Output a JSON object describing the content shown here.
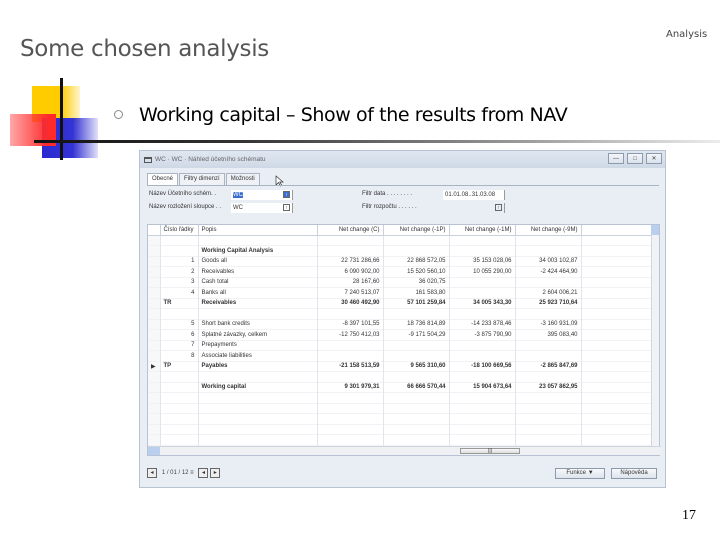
{
  "slide": {
    "title": "Some chosen  analysis",
    "tag": "Analysis",
    "number": "17",
    "bullet": "Working capital – Show of the results from NAV"
  },
  "window": {
    "title": "WC · WC · Náhled účetního schématu",
    "icon": "window-icon",
    "buttons": {
      "minimize": "—",
      "restore": "□",
      "close": "✕"
    },
    "tabs": [
      "Obecné",
      "Filtry dimenzí",
      "Možnosti"
    ],
    "fields": {
      "schema_label": "Název Účetního schém. .",
      "schema_value": "WC",
      "layout_label": "Název rozložení sloupce . .",
      "layout_value": "WC",
      "date_filter_label": "Filtr data . . . . . . . .",
      "date_filter_value": "01.01.08..31.03.08",
      "budget_filter_label": "Filtr rozpočtu . . . . . .",
      "budget_filter_value": ""
    },
    "grid": {
      "headers": [
        "Číslo řádky",
        "Popis",
        "Net change (C)",
        "Net change (-1P)",
        "Net change (-1M)",
        "Net change (-9M)"
      ],
      "rows": [
        {
          "no": "",
          "desc": "",
          "c": "",
          "p1": "",
          "m1": "",
          "m9": "",
          "bold": false,
          "marker": ""
        },
        {
          "no": "",
          "desc": "Working Capital Analysis",
          "c": "",
          "p1": "",
          "m1": "",
          "m9": "",
          "bold": true,
          "marker": ""
        },
        {
          "no": "1",
          "desc": "Goods all",
          "c": "22 731 286,66",
          "p1": "22 868 572,05",
          "m1": "35 153 028,06",
          "m9": "34 003 102,87",
          "bold": false,
          "marker": ""
        },
        {
          "no": "2",
          "desc": "Receivables",
          "c": "6 090 902,00",
          "p1": "15 520 560,10",
          "m1": "10 055 290,00",
          "m9": "-2 424 464,90",
          "bold": false,
          "marker": ""
        },
        {
          "no": "3",
          "desc": "Cash total",
          "c": "28 167,60",
          "p1": "36 020,75",
          "m1": "",
          "m9": "",
          "bold": false,
          "marker": ""
        },
        {
          "no": "4",
          "desc": "Banks all",
          "c": "7 240 513,07",
          "p1": "161 583,80",
          "m1": "",
          "m9": "2 604 006,21",
          "bold": false,
          "marker": ""
        },
        {
          "no": "TR",
          "desc": "Receivables",
          "c": "30 460 492,90",
          "p1": "57 101 259,84",
          "m1": "34 005 343,30",
          "m9": "25 923 710,64",
          "bold": true,
          "marker": ""
        },
        {
          "no": "",
          "desc": "",
          "c": "",
          "p1": "",
          "m1": "",
          "m9": "",
          "bold": false,
          "marker": ""
        },
        {
          "no": "5",
          "desc": "Short bank credits",
          "c": "-8 397 101,55",
          "p1": "18 736 814,89",
          "m1": "-14 233 878,46",
          "m9": "-3 160 931,09",
          "bold": false,
          "marker": ""
        },
        {
          "no": "6",
          "desc": "Splatné závazky, celkem",
          "c": "-12 750 412,03",
          "p1": "-9 171 504,29",
          "m1": "-3 875 790,90",
          "m9": "395 083,40",
          "bold": false,
          "marker": ""
        },
        {
          "no": "7",
          "desc": "Prepayments",
          "c": "",
          "p1": "",
          "m1": "",
          "m9": "",
          "bold": false,
          "marker": ""
        },
        {
          "no": "8",
          "desc": "Associate liabilities",
          "c": "",
          "p1": "",
          "m1": "",
          "m9": "",
          "bold": false,
          "marker": ""
        },
        {
          "no": "TP",
          "desc": "Payables",
          "c": "-21 158 513,59",
          "p1": "9 565 310,60",
          "m1": "-18 100 669,56",
          "m9": "-2 865 847,69",
          "bold": true,
          "marker": "▶"
        },
        {
          "no": "",
          "desc": "",
          "c": "",
          "p1": "",
          "m1": "",
          "m9": "",
          "bold": false,
          "marker": ""
        },
        {
          "no": "",
          "desc": "Working capital",
          "c": "9 301 979,31",
          "p1": "66 666 570,44",
          "m1": "15 904 673,64",
          "m9": "23 057 862,95",
          "bold": true,
          "marker": ""
        },
        {
          "no": "",
          "desc": "",
          "c": "",
          "p1": "",
          "m1": "",
          "m9": "",
          "bold": false,
          "marker": ""
        },
        {
          "no": "",
          "desc": "",
          "c": "",
          "p1": "",
          "m1": "",
          "m9": "",
          "bold": false,
          "marker": ""
        },
        {
          "no": "",
          "desc": "",
          "c": "",
          "p1": "",
          "m1": "",
          "m9": "",
          "bold": false,
          "marker": ""
        },
        {
          "no": "",
          "desc": "",
          "c": "",
          "p1": "",
          "m1": "",
          "m9": "",
          "bold": false,
          "marker": ""
        },
        {
          "no": "",
          "desc": "",
          "c": "",
          "p1": "",
          "m1": "",
          "m9": "",
          "bold": false,
          "marker": ""
        }
      ]
    },
    "footer": {
      "first_btn": "◂",
      "period_text": "1 / 01 / 12 ≡",
      "prev_btn": "◂",
      "next_btn": "▸",
      "funkce_label": "Funkce",
      "funkce_arrow": "▼",
      "help_label": "Nápověda"
    }
  }
}
